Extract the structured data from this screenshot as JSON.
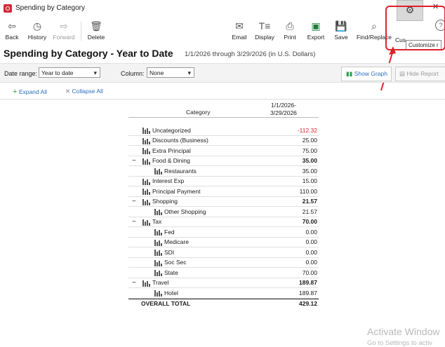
{
  "window": {
    "title": "Spending by Category"
  },
  "toolbar": {
    "back": "Back",
    "history": "History",
    "forward": "Forward",
    "delete": "Delete",
    "email": "Email",
    "display": "Display",
    "print": "Print",
    "export": "Export",
    "save": "Save",
    "find_replace": "Find/Replace",
    "customize": "Cus",
    "tooltip": "Customize r"
  },
  "report": {
    "title": "Spending by Category - Year to Date",
    "subtitle": "1/1/2026 through 3/29/2026 (in U.S. Dollars)"
  },
  "filters": {
    "date_range_label": "Date range:",
    "date_range_value": "Year to date",
    "column_label": "Column:",
    "column_value": "None",
    "show_graph": "Show Graph",
    "hide_report": "Hide Report"
  },
  "actions": {
    "expand_all": "Expand All",
    "collapse_all": "Collapse All"
  },
  "table": {
    "col_category": "Category",
    "col_date_line1": "1/1/2026-",
    "col_date_line2": "3/29/2026",
    "rows": [
      {
        "label": "Uncategorized",
        "amount": "-112.32"
      },
      {
        "label": "Discounts (Business)",
        "amount": "25.00"
      },
      {
        "label": "Extra Principal",
        "amount": "75.00"
      },
      {
        "label": "Food & Dining",
        "amount": "35.00"
      },
      {
        "label": "Restaurants",
        "amount": "35.00"
      },
      {
        "label": "Interest Exp",
        "amount": "15.00"
      },
      {
        "label": "Principal Payment",
        "amount": "110.00"
      },
      {
        "label": "Shopping",
        "amount": "21.57"
      },
      {
        "label": "Other Shopping",
        "amount": "21.57"
      },
      {
        "label": "Tax",
        "amount": "70.00"
      },
      {
        "label": "Fed",
        "amount": "0.00"
      },
      {
        "label": "Medicare",
        "amount": "0.00"
      },
      {
        "label": "SDI",
        "amount": "0.00"
      },
      {
        "label": "Soc Sec",
        "amount": "0.00"
      },
      {
        "label": "State",
        "amount": "70.00"
      },
      {
        "label": "Travel",
        "amount": "189.87"
      },
      {
        "label": "Hotel",
        "amount": "189.87"
      }
    ],
    "total_label": "OVERALL TOTAL",
    "total_amount": "429.12"
  },
  "watermark": {
    "line1": "Activate Window",
    "line2": "Go to Settings to activ"
  },
  "colors": {
    "accent": "#2b6fbf",
    "negative": "#e0202a",
    "highlight": "#e0202a"
  }
}
